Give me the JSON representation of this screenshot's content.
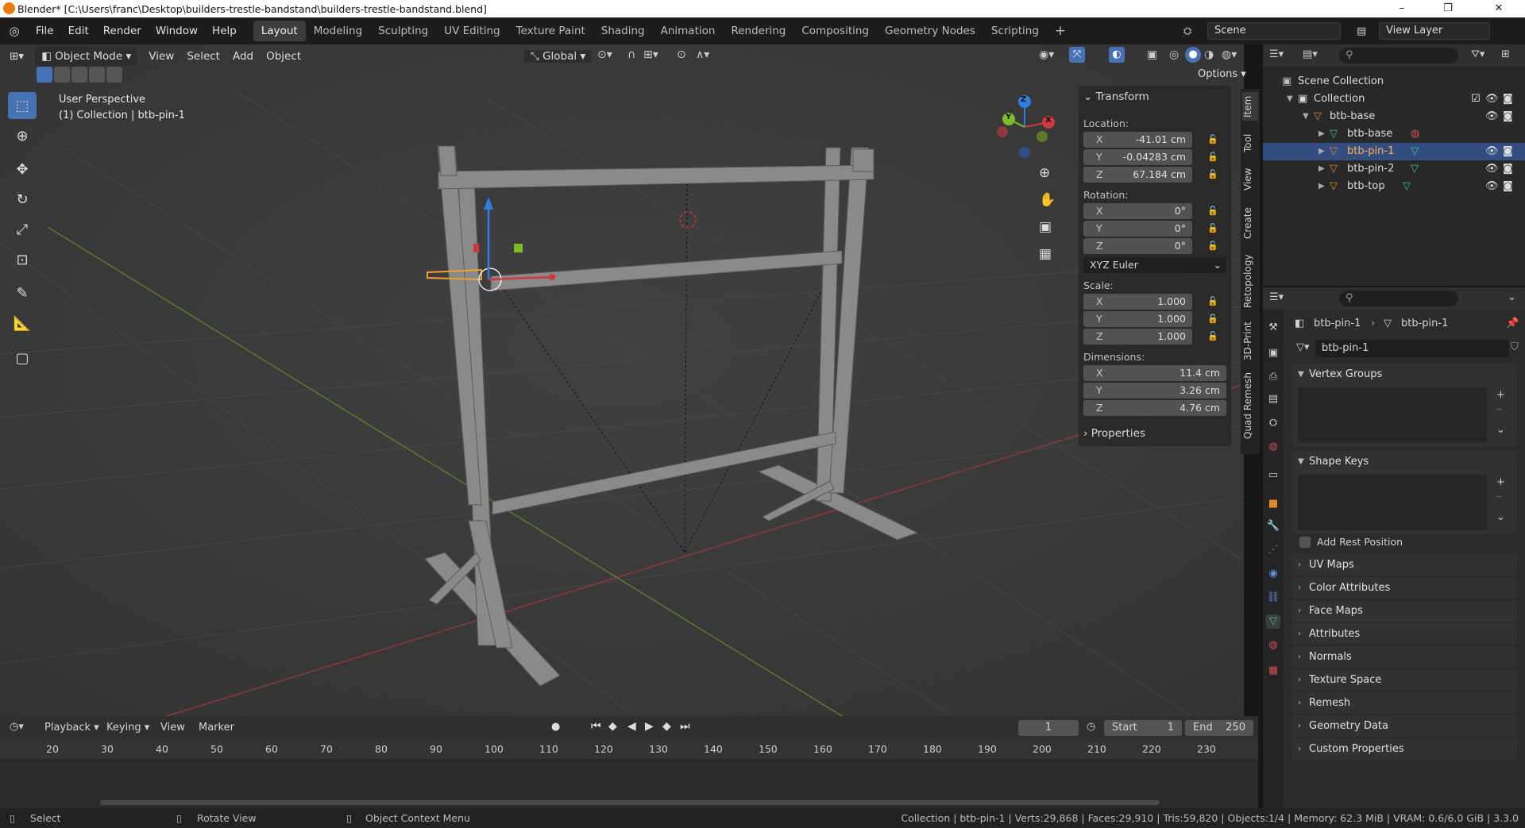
{
  "titlebar": {
    "title": "Blender* [C:\\Users\\franc\\Desktop\\builders-trestle-bandstand\\builders-trestle-bandstand.blend]",
    "minimize": "–",
    "maximize": "❐",
    "close": "✕"
  },
  "menu": [
    "File",
    "Edit",
    "Render",
    "Window",
    "Help"
  ],
  "workspaces": [
    "Layout",
    "Modeling",
    "Sculpting",
    "UV Editing",
    "Texture Paint",
    "Shading",
    "Animation",
    "Rendering",
    "Compositing",
    "Geometry Nodes",
    "Scripting"
  ],
  "active_workspace": "Layout",
  "add_workspace": "+",
  "scene": {
    "label": "Scene",
    "view_layer": "View Layer"
  },
  "viewport_header": {
    "mode": "Object Mode",
    "menus": [
      "View",
      "Select",
      "Add",
      "Object"
    ],
    "orientation": "Global",
    "options": "Options"
  },
  "viewport": {
    "perspective": "User Perspective",
    "collection_info": "(1) Collection | btb-pin-1",
    "gizmo_x": "X",
    "gizmo_y": "Y",
    "gizmo_z": "Z"
  },
  "tools": [
    "select-box-tool",
    "cursor-tool",
    "move-tool",
    "rotate-tool",
    "scale-tool",
    "transform-tool",
    "annotate-tool",
    "measure-tool",
    "add-cube-tool"
  ],
  "npanel": {
    "section": "Transform",
    "location_label": "Location:",
    "location": [
      {
        "axis": "X",
        "value": "-41.01 cm"
      },
      {
        "axis": "Y",
        "value": "-0.04283 cm"
      },
      {
        "axis": "Z",
        "value": "67.184 cm"
      }
    ],
    "rotation_label": "Rotation:",
    "rotation": [
      {
        "axis": "X",
        "value": "0°"
      },
      {
        "axis": "Y",
        "value": "0°"
      },
      {
        "axis": "Z",
        "value": "0°"
      }
    ],
    "rotation_mode": "XYZ Euler",
    "scale_label": "Scale:",
    "scale": [
      {
        "axis": "X",
        "value": "1.000"
      },
      {
        "axis": "Y",
        "value": "1.000"
      },
      {
        "axis": "Z",
        "value": "1.000"
      }
    ],
    "dimensions_label": "Dimensions:",
    "dimensions": [
      {
        "axis": "X",
        "value": "11.4 cm"
      },
      {
        "axis": "Y",
        "value": "3.26 cm"
      },
      {
        "axis": "Z",
        "value": "4.76 cm"
      }
    ],
    "properties": "Properties"
  },
  "side_tabs": [
    "Item",
    "Tool",
    "View",
    "Create",
    "Retopology",
    "3D-Print",
    "Quad Remesh"
  ],
  "outliner": {
    "scene_collection": "Scene Collection",
    "rows": [
      {
        "name": "Collection",
        "level": 1
      },
      {
        "name": "btb-base",
        "level": 2
      },
      {
        "name": "btb-base",
        "level": 3
      },
      {
        "name": "btb-pin-1",
        "level": 3,
        "selected": true
      },
      {
        "name": "btb-pin-2",
        "level": 3
      },
      {
        "name": "btb-top",
        "level": 3
      }
    ]
  },
  "properties": {
    "breadcrumb_object": "btb-pin-1",
    "breadcrumb_data": "btb-pin-1",
    "mesh_name": "btb-pin-1",
    "vertex_groups": "Vertex Groups",
    "shape_keys": "Shape Keys",
    "add_rest_position": "Add Rest Position",
    "collapsed": [
      "UV Maps",
      "Color Attributes",
      "Face Maps",
      "Attributes",
      "Normals",
      "Texture Space",
      "Remesh",
      "Geometry Data",
      "Custom Properties"
    ]
  },
  "timeline": {
    "menus": [
      "Playback",
      "Keying",
      "View",
      "Marker"
    ],
    "current_frame": "1",
    "start_label": "Start",
    "start": "1",
    "end_label": "End",
    "end": "250",
    "ticks": [
      "20",
      "30",
      "40",
      "50",
      "60",
      "70",
      "80",
      "90",
      "100",
      "110",
      "120",
      "130",
      "140",
      "150",
      "160",
      "170",
      "180",
      "190",
      "200",
      "210",
      "220",
      "230"
    ]
  },
  "statusbar": {
    "select": "Select",
    "rotate": "Rotate View",
    "context": "Object Context Menu",
    "stats": "Collection | btb-pin-1 | Verts:29,868 | Faces:29,910 | Tris:59,820 | Objects:1/4 | Memory: 62.3 MiB | VRAM: 0.6/6.0 GiB | 3.3.0"
  },
  "colors": {
    "accent": "#4772b3",
    "selection": "#f0a030",
    "axis_x": "#d0383f",
    "axis_y": "#7dbb2a",
    "axis_z": "#2f7ee0"
  }
}
